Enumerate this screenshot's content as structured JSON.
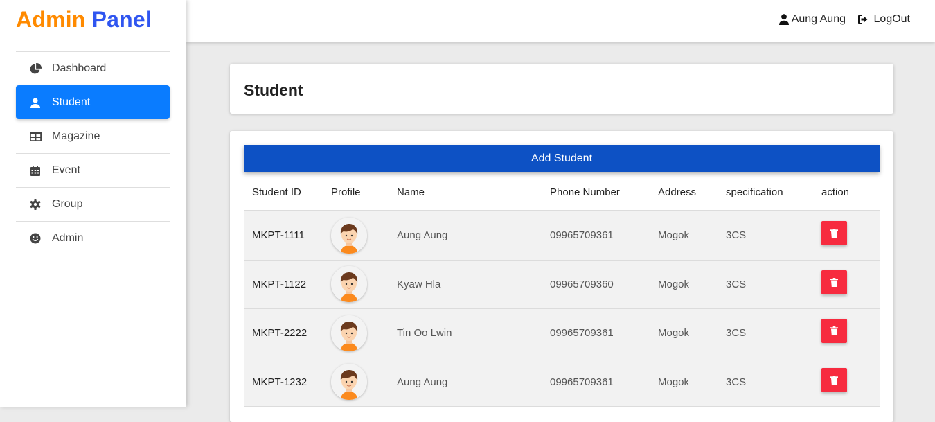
{
  "brand": {
    "part1": "Admin",
    "part2": "Panel"
  },
  "sidebar": {
    "items": [
      {
        "label": "Dashboard",
        "icon": "pie-chart-icon"
      },
      {
        "label": "Student",
        "icon": "user-icon",
        "active": true
      },
      {
        "label": "Magazine",
        "icon": "table-icon"
      },
      {
        "label": "Event",
        "icon": "calendar-icon"
      },
      {
        "label": "Group",
        "icon": "cog-icon"
      },
      {
        "label": "Admin",
        "icon": "smiley-icon"
      }
    ]
  },
  "topbar": {
    "user_name": "Aung Aung",
    "logout_label": "LogOut"
  },
  "page": {
    "title": "Student",
    "add_button": "Add Student"
  },
  "table": {
    "headers": [
      "Student ID",
      "Profile",
      "Name",
      "Phone Number",
      "Address",
      "specification",
      "action"
    ],
    "rows": [
      {
        "id": "MKPT-1111",
        "name": "Aung Aung",
        "phone": "09965709361",
        "address": "Mogok",
        "spec": "3CS"
      },
      {
        "id": "MKPT-1122",
        "name": "Kyaw Hla",
        "phone": "09965709360",
        "address": "Mogok",
        "spec": "3CS"
      },
      {
        "id": "MKPT-2222",
        "name": "Tin Oo Lwin",
        "phone": "09965709361",
        "address": "Mogok",
        "spec": "3CS"
      },
      {
        "id": "MKPT-1232",
        "name": "Aung Aung",
        "phone": "09965709361",
        "address": "Mogok",
        "spec": "3CS"
      }
    ]
  },
  "colors": {
    "brand_orange": "#ff8a00",
    "brand_blue": "#2f55f0",
    "active_blue": "#0a7cff",
    "add_button": "#0d51c4",
    "delete_red": "#f72b3f"
  }
}
